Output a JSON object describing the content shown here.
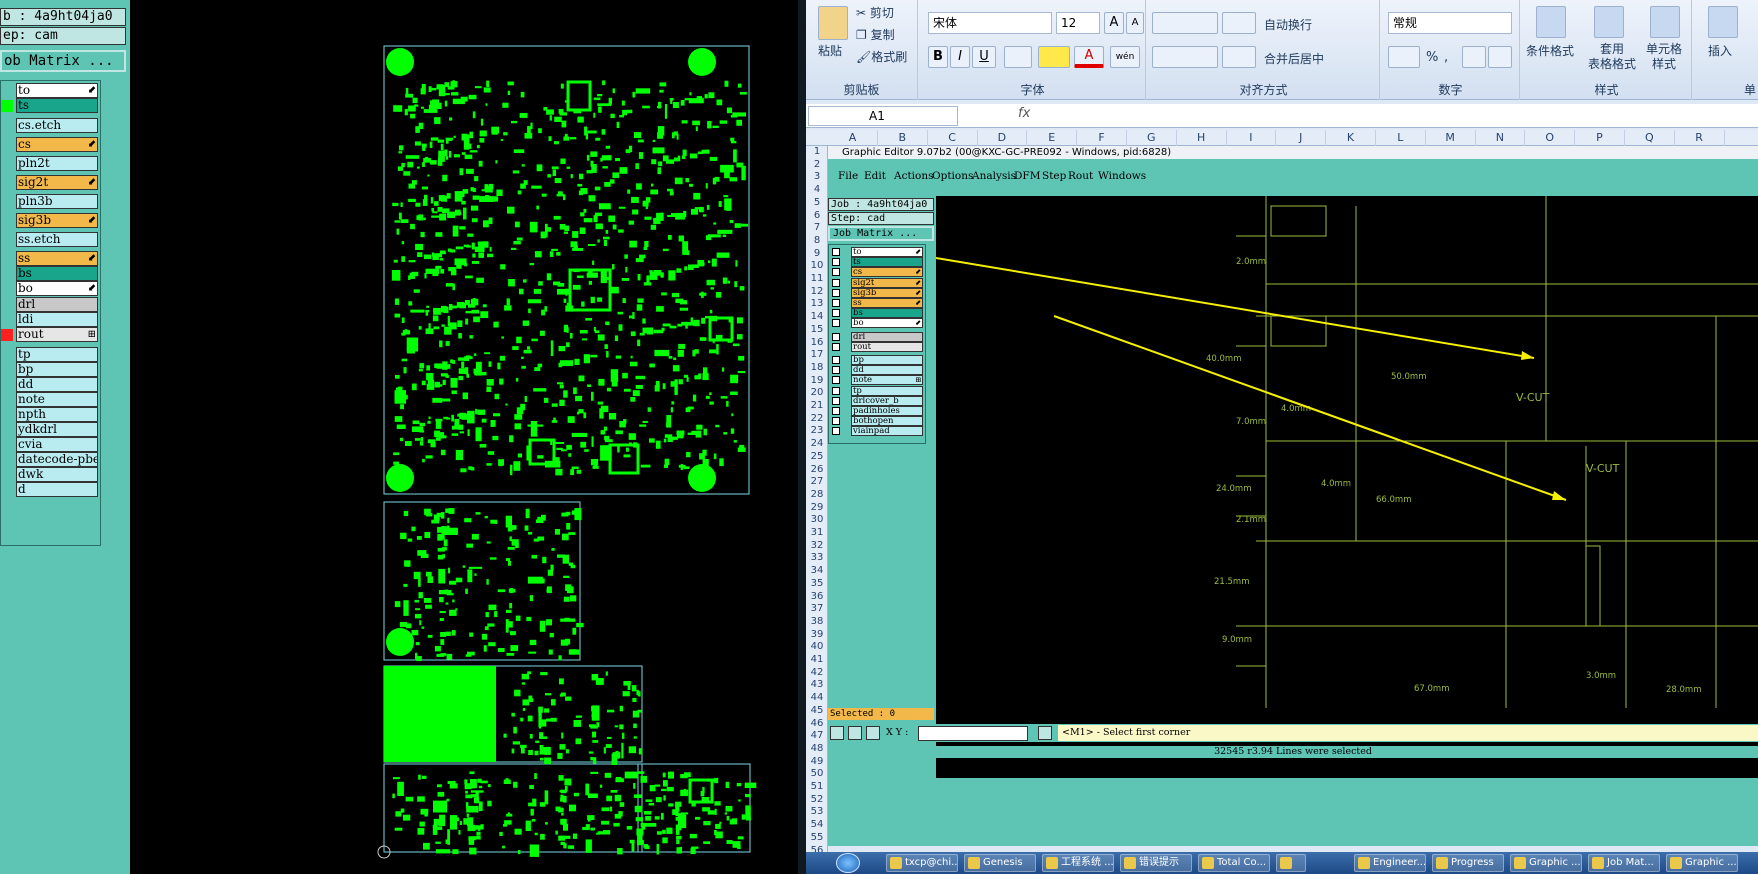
{
  "cam": {
    "job_line": "b : 4a9ht04ja0",
    "step_line": "ep: cam",
    "matrix_button": "ob Matrix ...",
    "layers": [
      {
        "name": "to",
        "color": "#ffffff",
        "box": "#5ec4b4",
        "mark": "⬋"
      },
      {
        "name": "ts",
        "color": "#19a58c",
        "box": "#00ff00",
        "mark": ""
      },
      {
        "name": "cs.etch",
        "color": "#b8ecf0",
        "box": "#5ec4b4",
        "mark": ""
      },
      {
        "name": "cs",
        "color": "#f2b84a",
        "box": "#5ec4b4",
        "mark": "⬋"
      },
      {
        "name": "pln2t",
        "color": "#b8ecf0",
        "box": "#5ec4b4",
        "mark": ""
      },
      {
        "name": "sig2t",
        "color": "#f2b84a",
        "box": "#5ec4b4",
        "mark": "⬋"
      },
      {
        "name": "pln3b",
        "color": "#b8ecf0",
        "box": "#5ec4b4",
        "mark": ""
      },
      {
        "name": "sig3b",
        "color": "#f2b84a",
        "box": "#5ec4b4",
        "mark": "⬋"
      },
      {
        "name": "ss.etch",
        "color": "#b8ecf0",
        "box": "#5ec4b4",
        "mark": ""
      },
      {
        "name": "ss",
        "color": "#f2b84a",
        "box": "#5ec4b4",
        "mark": "⬋"
      },
      {
        "name": "bs",
        "color": "#19a58c",
        "box": "#5ec4b4",
        "mark": ""
      },
      {
        "name": "bo",
        "color": "#ffffff",
        "box": "#5ec4b4",
        "mark": "⬋"
      },
      {
        "name": "drl",
        "color": "#c8c8c8",
        "box": "#5ec4b4",
        "mark": ""
      },
      {
        "name": "ldi",
        "color": "#b8ecf0",
        "box": "#5ec4b4",
        "mark": ""
      },
      {
        "name": "rout",
        "color": "#e6e6e6",
        "box": "#ff2020",
        "mark": "⊞"
      },
      {
        "name": "tp",
        "color": "#b8ecf0",
        "box": "#5ec4b4",
        "mark": ""
      },
      {
        "name": "bp",
        "color": "#b8ecf0",
        "box": "#5ec4b4",
        "mark": ""
      },
      {
        "name": "dd",
        "color": "#b8ecf0",
        "box": "#5ec4b4",
        "mark": ""
      },
      {
        "name": "note",
        "color": "#b8ecf0",
        "box": "#5ec4b4",
        "mark": ""
      },
      {
        "name": "npth",
        "color": "#b8ecf0",
        "box": "#5ec4b4",
        "mark": ""
      },
      {
        "name": "ydkdrl",
        "color": "#b8ecf0",
        "box": "#5ec4b4",
        "mark": ""
      },
      {
        "name": "cvia",
        "color": "#b8ecf0",
        "box": "#5ec4b4",
        "mark": ""
      },
      {
        "name": "datecode-pbe",
        "color": "#b8ecf0",
        "box": "#5ec4b4",
        "mark": ""
      },
      {
        "name": "dwk",
        "color": "#b8ecf0",
        "box": "#5ec4b4",
        "mark": ""
      },
      {
        "name": "d",
        "color": "#b8ecf0",
        "box": "#5ec4b4",
        "mark": ""
      }
    ]
  },
  "excel": {
    "clipboard": {
      "paste": "粘贴",
      "cut": "剪切",
      "copy": "复制",
      "format_painter": "格式刷",
      "group": "剪贴板"
    },
    "font": {
      "name": "宋体",
      "size": "12",
      "bold": "B",
      "italic": "I",
      "underline": "U",
      "wen": "wén",
      "group": "字体",
      "grow": "A",
      "shrink": "A"
    },
    "alignment": {
      "wrap": "自动换行",
      "merge": "合并后居中",
      "group": "对齐方式"
    },
    "number": {
      "format": "常规",
      "percent": "%",
      "comma": ",",
      "group": "数字"
    },
    "styles": {
      "cond": "条件格式",
      "table": "套用\n表格格式",
      "cell": "单元格\n样式",
      "group": "样式"
    },
    "insert": {
      "label": "插入",
      "group": "单"
    },
    "namebox": "A1",
    "fx": "fx",
    "columns": [
      "A",
      "B",
      "C",
      "D",
      "E",
      "F",
      "G",
      "H",
      "I",
      "J",
      "K",
      "L",
      "M",
      "N",
      "O",
      "P",
      "Q",
      "R"
    ],
    "rows": [
      "1",
      "2",
      "3",
      "4",
      "5",
      "6",
      "7",
      "8",
      "9",
      "10",
      "11",
      "12",
      "13",
      "14",
      "15",
      "16",
      "17",
      "18",
      "19",
      "20",
      "21",
      "22",
      "23",
      "24",
      "25",
      "26",
      "27",
      "28",
      "29",
      "30",
      "31",
      "32",
      "33",
      "34",
      "35",
      "36",
      "37",
      "38",
      "39",
      "40",
      "41",
      "42",
      "43",
      "44",
      "45",
      "46",
      "47",
      "48",
      "49",
      "50",
      "51",
      "52",
      "53",
      "54",
      "55",
      "56"
    ]
  },
  "ge": {
    "title": "Graphic Editor 9.07b2 (00@KXC-GC-PRE092 - Windows, pid:6828)",
    "menu": [
      "File",
      "Edit",
      "Actions",
      "Options",
      "Analysis",
      "DFM",
      "Step",
      "Rout",
      "Windows"
    ],
    "job_line": "Job : 4a9ht04ja0",
    "step_line": "Step: cad",
    "matrix_button": "Job Matrix ...",
    "layers": [
      {
        "name": "to",
        "color": "#ffffff",
        "mark": "⬋"
      },
      {
        "name": "ts",
        "color": "#19a58c",
        "mark": ""
      },
      {
        "name": "cs",
        "color": "#f2b84a",
        "mark": "⬋"
      },
      {
        "name": "sig2t",
        "color": "#f2b84a",
        "mark": "⬋"
      },
      {
        "name": "sig3b",
        "color": "#f2b84a",
        "mark": "⬋"
      },
      {
        "name": "ss",
        "color": "#f2b84a",
        "mark": "⬋"
      },
      {
        "name": "bs",
        "color": "#19a58c",
        "mark": ""
      },
      {
        "name": "bo",
        "color": "#ffffff",
        "mark": "⬋"
      },
      {
        "name": "drl",
        "color": "#c8c8c8",
        "mark": ""
      },
      {
        "name": "rout",
        "color": "#e6e6e6",
        "mark": ""
      },
      {
        "name": "bp",
        "color": "#b8ecf0",
        "mark": ""
      },
      {
        "name": "dd",
        "color": "#b8ecf0",
        "mark": ""
      },
      {
        "name": "note",
        "color": "#b8ecf0",
        "mark": "⊞"
      },
      {
        "name": "tp",
        "color": "#b8ecf0",
        "mark": ""
      },
      {
        "name": "drlcover_b",
        "color": "#b8ecf0",
        "mark": ""
      },
      {
        "name": "padinholes",
        "color": "#b8ecf0",
        "mark": ""
      },
      {
        "name": "bothopen",
        "color": "#b8ecf0",
        "mark": ""
      },
      {
        "name": "viainpad",
        "color": "#b8ecf0",
        "mark": ""
      }
    ],
    "selected": "Selected : 0",
    "xy_label": "X Y :",
    "prompt": "<M1> - Select first corner",
    "message": "32545 r3.94 Lines were selected",
    "dims": [
      {
        "text": "2.0mm"
      },
      {
        "text": "40.0mm"
      },
      {
        "text": "50.0mm"
      },
      {
        "text": "V-CUT"
      },
      {
        "text": "4.0mm"
      },
      {
        "text": "7.0mm"
      },
      {
        "text": "4.0mm"
      },
      {
        "text": "V-CUT"
      },
      {
        "text": "24.0mm"
      },
      {
        "text": "66.0mm"
      },
      {
        "text": "2.1mm"
      },
      {
        "text": "21.5mm"
      },
      {
        "text": "9.0mm"
      },
      {
        "text": "3.0mm"
      },
      {
        "text": "67.0mm"
      },
      {
        "text": "28.0mm"
      }
    ]
  },
  "taskbar": [
    "txcp@chi...",
    "Genesis",
    "工程系统 ...",
    "错误提示",
    "Total Co...",
    "",
    "Engineer...",
    "Progress",
    "Graphic ...",
    "Job Mat...",
    "Graphic ..."
  ]
}
